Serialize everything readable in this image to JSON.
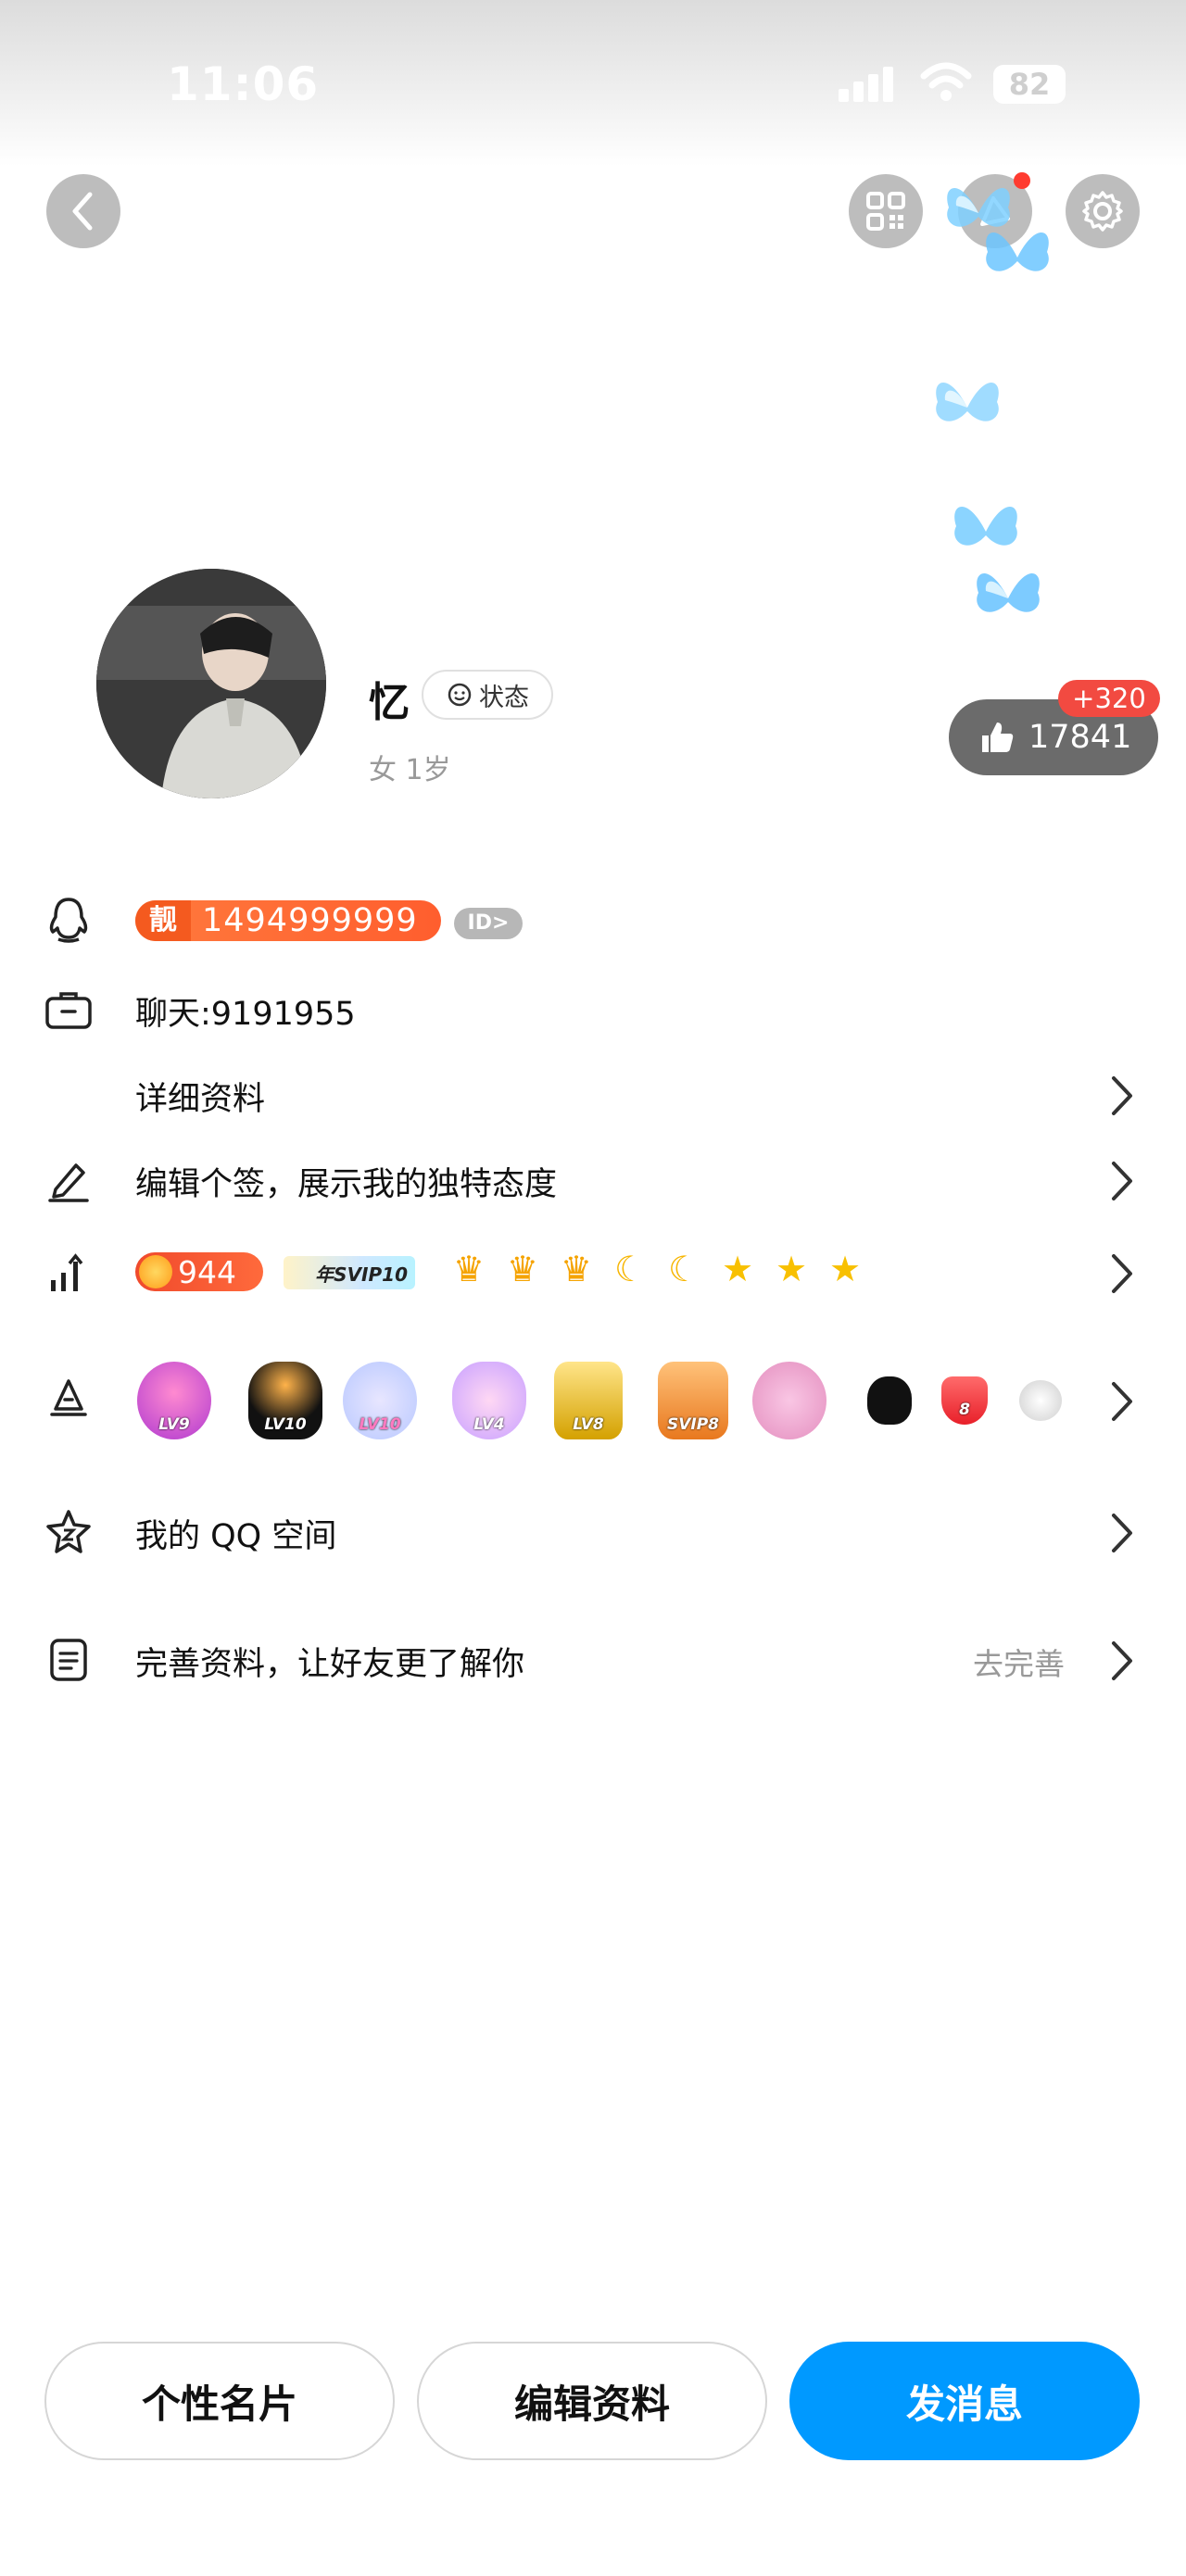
{
  "status_bar": {
    "time": "11:06",
    "battery": "82"
  },
  "profile": {
    "nickname": "忆",
    "status_label": "状态",
    "sub_info": "女  1岁",
    "likes": "17841",
    "likes_delta": "+320"
  },
  "rows": {
    "qq_prefix": "靓",
    "qq_number": "1494999999",
    "id_badge": "ID>",
    "chat_id": "聊天:9191955",
    "detail": "详细资料",
    "signature": "编辑个签，展示我的独特态度",
    "sun_value": "944",
    "svip_tag": "年SVIP10",
    "qzone": "我的 QQ 空间",
    "complete": "完善资料，让好友更了解你",
    "complete_action": "去完善"
  },
  "medals": [
    "LV9",
    "LV10",
    "LV10",
    "LV4",
    "LV8",
    "SVIP8",
    "",
    "",
    "8",
    ""
  ],
  "levels": [
    "crown",
    "crown",
    "crown",
    "moon",
    "moon",
    "star",
    "star",
    "star"
  ],
  "buttons": {
    "card": "个性名片",
    "edit": "编辑资料",
    "message": "发消息"
  },
  "colors": {
    "accent": "#0099ff",
    "pill": "#ff5e2e",
    "like_badge": "#6b6b6b"
  }
}
